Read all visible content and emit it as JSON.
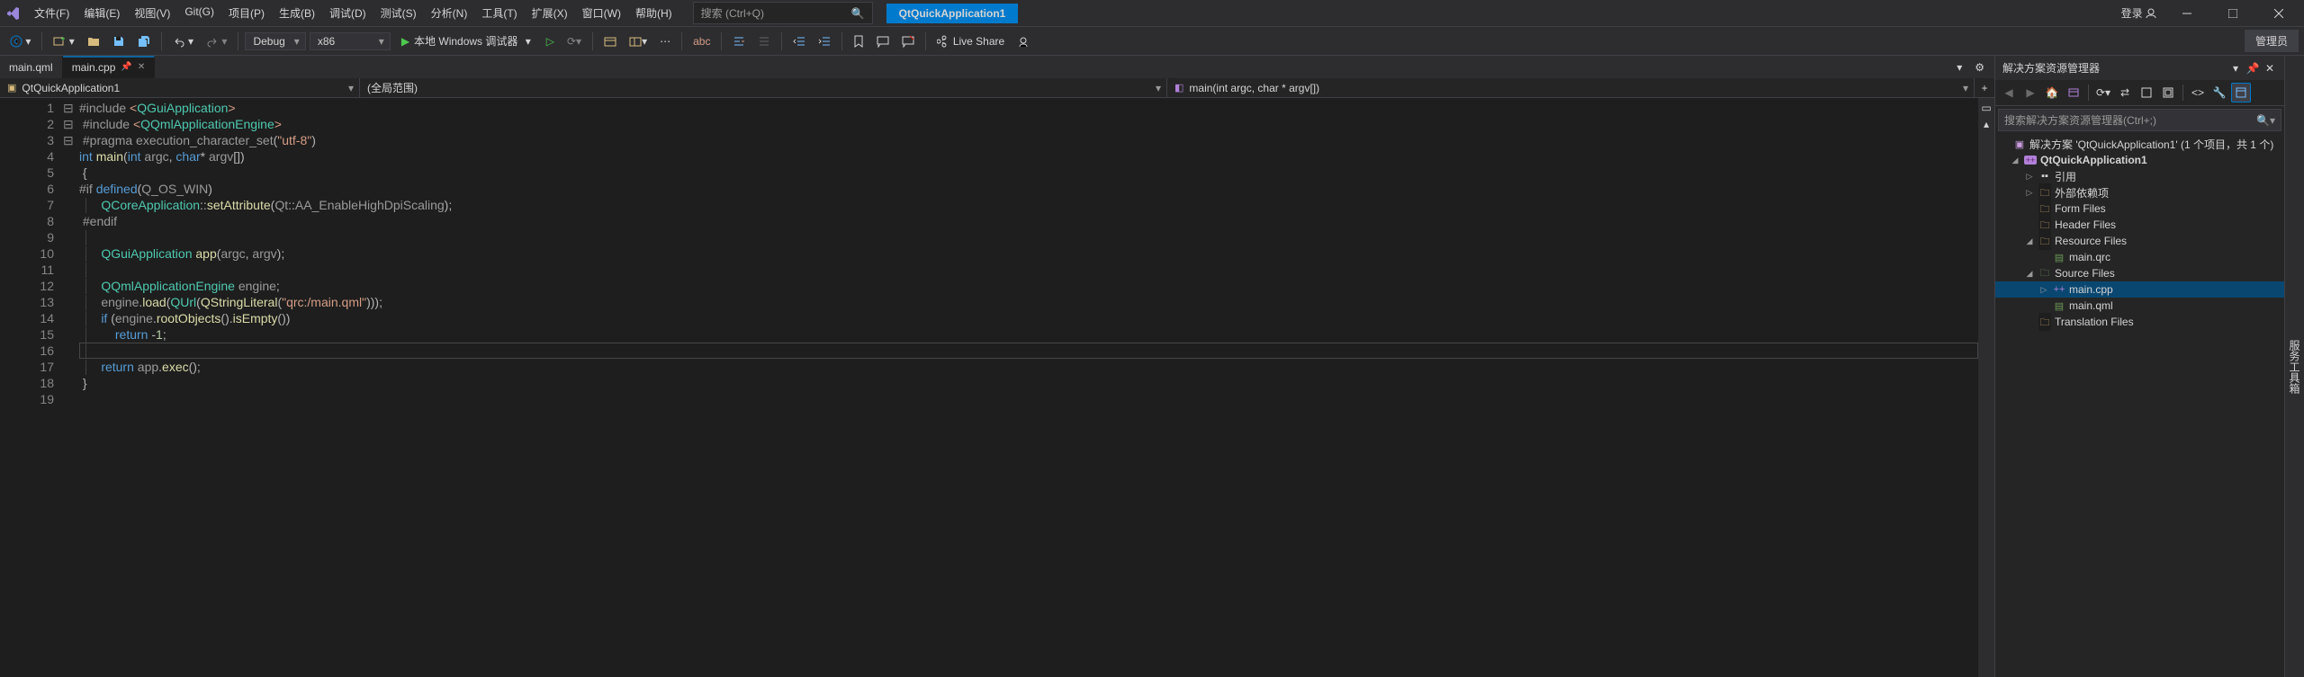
{
  "menu": [
    "文件(F)",
    "编辑(E)",
    "视图(V)",
    "Git(G)",
    "项目(P)",
    "生成(B)",
    "调试(D)",
    "测试(S)",
    "分析(N)",
    "工具(T)",
    "扩展(X)",
    "窗口(W)",
    "帮助(H)"
  ],
  "search_placeholder": "搜索 (Ctrl+Q)",
  "project_name": "QtQuickApplication1",
  "login": "登录",
  "config": "Debug",
  "platform": "x86",
  "run_label": "本地 Windows 调试器",
  "live_share": "Live Share",
  "admin": "管理员",
  "tabs": [
    {
      "label": "main.qml",
      "active": false
    },
    {
      "label": "main.cpp",
      "active": true
    }
  ],
  "nav": {
    "project": "QtQuickApplication1",
    "scope": "(全局范围)",
    "func": "main(int argc, char * argv[])"
  },
  "solution_panel": {
    "title": "解决方案资源管理器",
    "search_placeholder": "搜索解决方案资源管理器(Ctrl+;)",
    "sol_label": "解决方案 'QtQuickApplication1' (1 个项目，共 1 个)",
    "project": "QtQuickApplication1",
    "refs": "引用",
    "ext": "外部依赖项",
    "form": "Form Files",
    "header": "Header Files",
    "resource": "Resource Files",
    "qrc": "main.qrc",
    "source": "Source Files",
    "maincpp": "main.cpp",
    "mainqml": "main.qml",
    "trans": "Translation Files"
  },
  "right_strip": "服务工具箱",
  "code": {
    "lines": 19,
    "current": 16
  }
}
